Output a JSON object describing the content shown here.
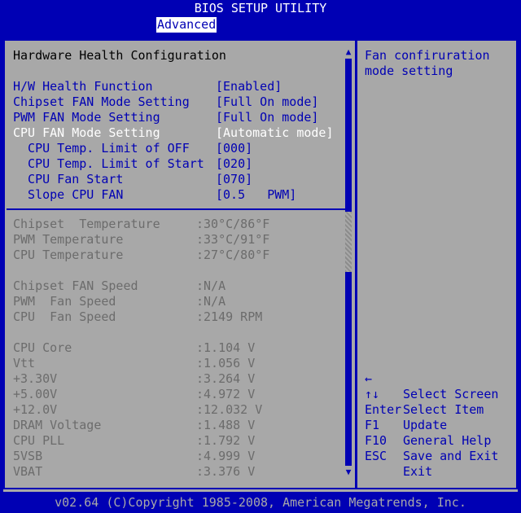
{
  "title": "BIOS SETUP UTILITY",
  "tab": "Advanced",
  "section_title": "Hardware Health Configuration",
  "settings": [
    {
      "label": "H/W Health Function",
      "value": "[Enabled]",
      "state": "normal"
    },
    {
      "label": "Chipset FAN Mode Setting",
      "value": "[Full On mode]",
      "state": "normal"
    },
    {
      "label": "PWM FAN Mode Setting",
      "value": "[Full On mode]",
      "state": "normal"
    },
    {
      "label": "CPU FAN Mode Setting",
      "value": "[Automatic mode]",
      "state": "selected"
    },
    {
      "label": "  CPU Temp. Limit of OFF",
      "value": "[000]",
      "state": "normal"
    },
    {
      "label": "  CPU Temp. Limit of Start",
      "value": "[020]",
      "state": "normal"
    },
    {
      "label": "  CPU Fan Start",
      "value": "[070]",
      "state": "normal"
    },
    {
      "label": "  Slope CPU FAN",
      "value": "[0.5   PWM]",
      "state": "normal"
    }
  ],
  "temperatures": [
    {
      "label": "Chipset  Temperature",
      "value": ":30°C/86°F"
    },
    {
      "label": "PWM Temperature",
      "value": ":33°C/91°F"
    },
    {
      "label": "CPU Temperature",
      "value": ":27°C/80°F"
    }
  ],
  "fan_speeds": [
    {
      "label": "Chipset FAN Speed",
      "value": ":N/A"
    },
    {
      "label": "PWM  Fan Speed",
      "value": ":N/A"
    },
    {
      "label": "CPU  Fan Speed",
      "value": ":2149 RPM"
    }
  ],
  "voltages": [
    {
      "label": "CPU Core",
      "value": ":1.104 V"
    },
    {
      "label": "Vtt",
      "value": ":1.056 V"
    },
    {
      "label": "+3.30V",
      "value": ":3.264 V"
    },
    {
      "label": "+5.00V",
      "value": ":4.972 V"
    },
    {
      "label": "+12.0V",
      "value": ":12.032 V"
    },
    {
      "label": "DRAM Voltage",
      "value": ":1.488 V"
    },
    {
      "label": "CPU PLL",
      "value": ":1.792 V"
    },
    {
      "label": "5VSB",
      "value": ":4.999 V"
    },
    {
      "label": "VBAT",
      "value": ":3.376 V"
    }
  ],
  "help": {
    "line1": "Fan confiruration",
    "line2": "mode setting"
  },
  "keys": [
    {
      "key": "←",
      "desc": "Select Screen"
    },
    {
      "key": "↑↓",
      "desc": "Select Item"
    },
    {
      "key": "Enter",
      "desc": "Update"
    },
    {
      "key": "F1",
      "desc": "General Help"
    },
    {
      "key": "F10",
      "desc": "Save and Exit"
    },
    {
      "key": "ESC",
      "desc": "Exit"
    }
  ],
  "footer": "v02.64 (C)Copyright 1985-2008, American Megatrends, Inc.",
  "colors": {
    "background": "#0000b4",
    "panel": "#a8a8a8",
    "selected_text": "#ffffff",
    "option_text": "#0000b4",
    "readonly_text": "#6c6c6c"
  }
}
